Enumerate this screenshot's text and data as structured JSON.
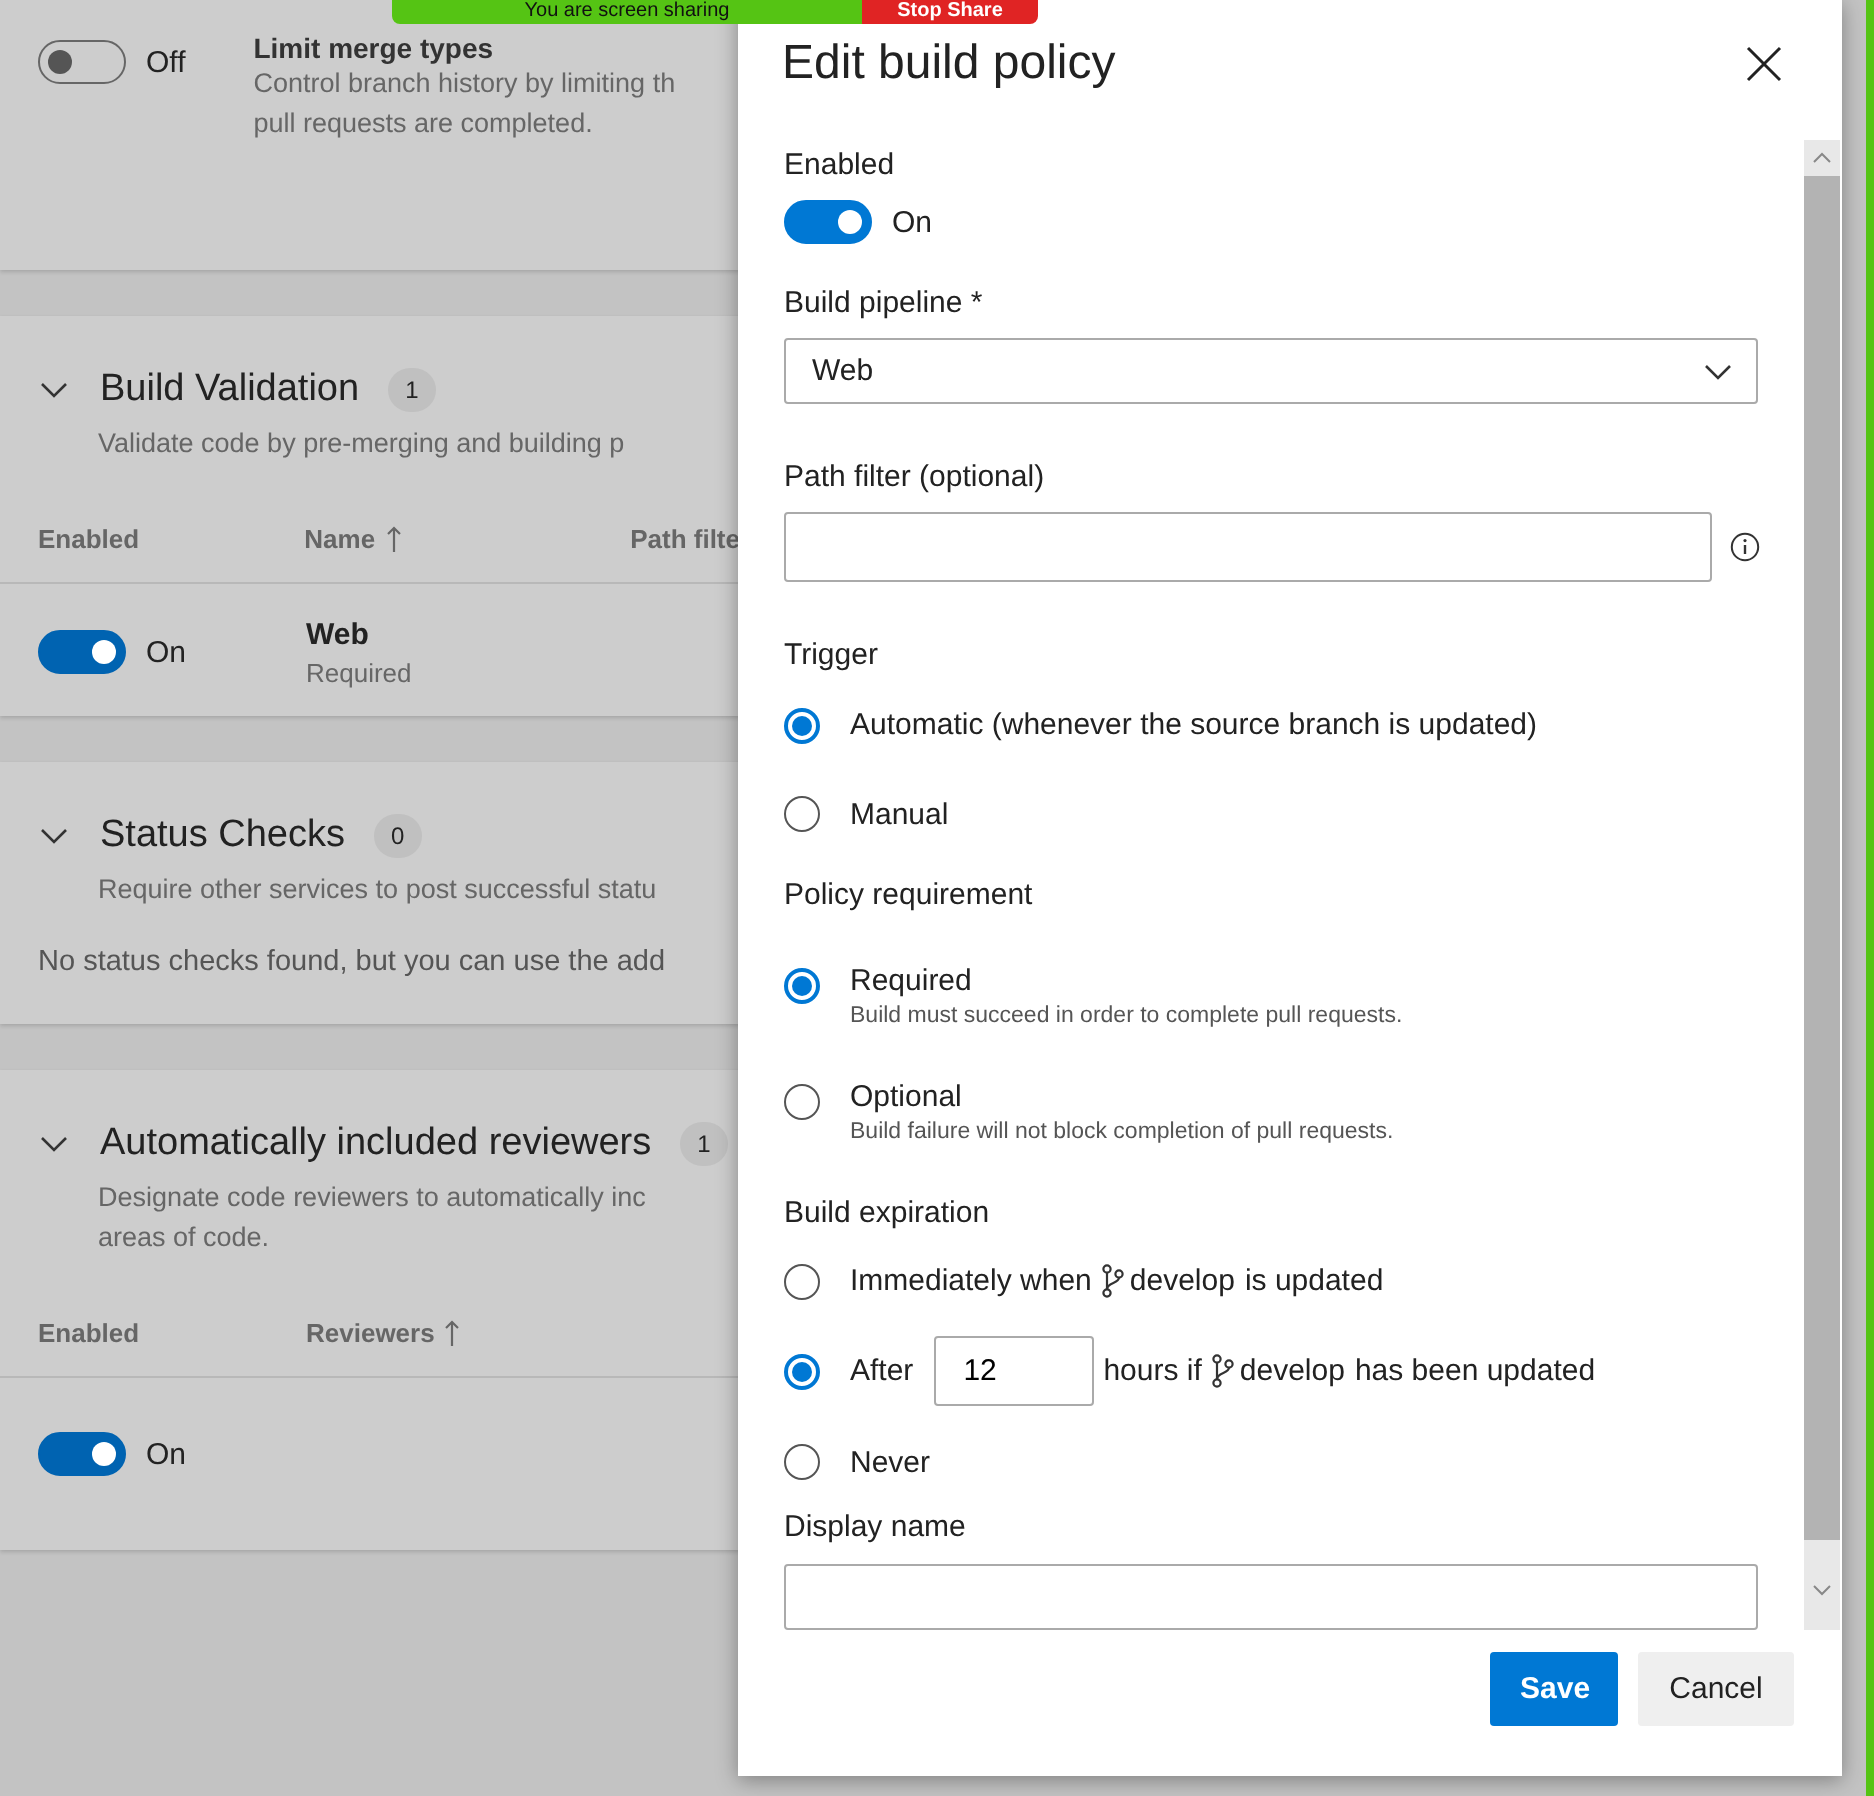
{
  "screen_share": {
    "message": "You are screen sharing",
    "stop_label": "Stop Share"
  },
  "background": {
    "merge_types": {
      "toggle_on": false,
      "toggle_label": "Off",
      "title": "Limit merge types",
      "description_lines": [
        "Control branch history by limiting th",
        "pull requests are completed."
      ]
    },
    "sections": [
      {
        "title": "Build Validation",
        "count": "1",
        "description_lines": [
          "Validate code by pre-merging and building p"
        ],
        "columns": [
          {
            "label": "Enabled",
            "sorted": false
          },
          {
            "label": "Name",
            "sorted": true
          },
          {
            "label": "Path filte",
            "sorted": false
          }
        ],
        "rows": [
          {
            "toggle_on": true,
            "toggle_label": "On",
            "name": "Web",
            "subtitle": "Required"
          }
        ]
      },
      {
        "title": "Status Checks",
        "count": "0",
        "description_lines": [
          "Require other services to post successful statu"
        ],
        "empty_message": "No status checks found, but you can use the add"
      },
      {
        "title": "Automatically included reviewers",
        "count": "1",
        "description_lines": [
          "Designate code reviewers to automatically inc",
          "areas of code."
        ],
        "columns": [
          {
            "label": "Enabled",
            "sorted": false
          },
          {
            "label": "Reviewers",
            "sorted": true
          }
        ],
        "rows": [
          {
            "toggle_on": true,
            "toggle_label": "On"
          }
        ]
      }
    ]
  },
  "panel": {
    "title": "Edit build policy",
    "enabled": {
      "label": "Enabled",
      "on": true,
      "state_label": "On"
    },
    "build_pipeline": {
      "label": "Build pipeline *",
      "value": "Web"
    },
    "path_filter": {
      "label": "Path filter (optional)"
    },
    "trigger": {
      "label": "Trigger",
      "options": [
        {
          "label": "Automatic (whenever the source branch is updated)",
          "selected": true
        },
        {
          "label": "Manual",
          "selected": false
        }
      ]
    },
    "policy_requirement": {
      "label": "Policy requirement",
      "options": [
        {
          "label": "Required",
          "description": "Build must succeed in order to complete pull requests.",
          "selected": true
        },
        {
          "label": "Optional",
          "description": "Build failure will not block completion of pull requests.",
          "selected": false
        }
      ]
    },
    "build_expiration": {
      "label": "Build expiration",
      "options": [
        {
          "selected": false,
          "parts": [
            {
              "kind": "text",
              "text": "Immediately when"
            },
            {
              "kind": "branch",
              "text": "develop"
            },
            {
              "kind": "text",
              "text": "is updated"
            }
          ]
        },
        {
          "selected": true,
          "parts": [
            {
              "kind": "text",
              "text": "After"
            },
            {
              "kind": "number",
              "value": "12"
            },
            {
              "kind": "text",
              "text": "hours if"
            },
            {
              "kind": "branch",
              "text": "develop"
            },
            {
              "kind": "text",
              "text": "has been updated"
            }
          ]
        },
        {
          "selected": false,
          "parts": [
            {
              "kind": "text",
              "text": "Never"
            }
          ]
        }
      ]
    },
    "display_name": {
      "label": "Display name"
    },
    "buttons": [
      {
        "label": "Save",
        "kind": "primary"
      },
      {
        "label": "Cancel",
        "kind": "secondary"
      }
    ]
  }
}
